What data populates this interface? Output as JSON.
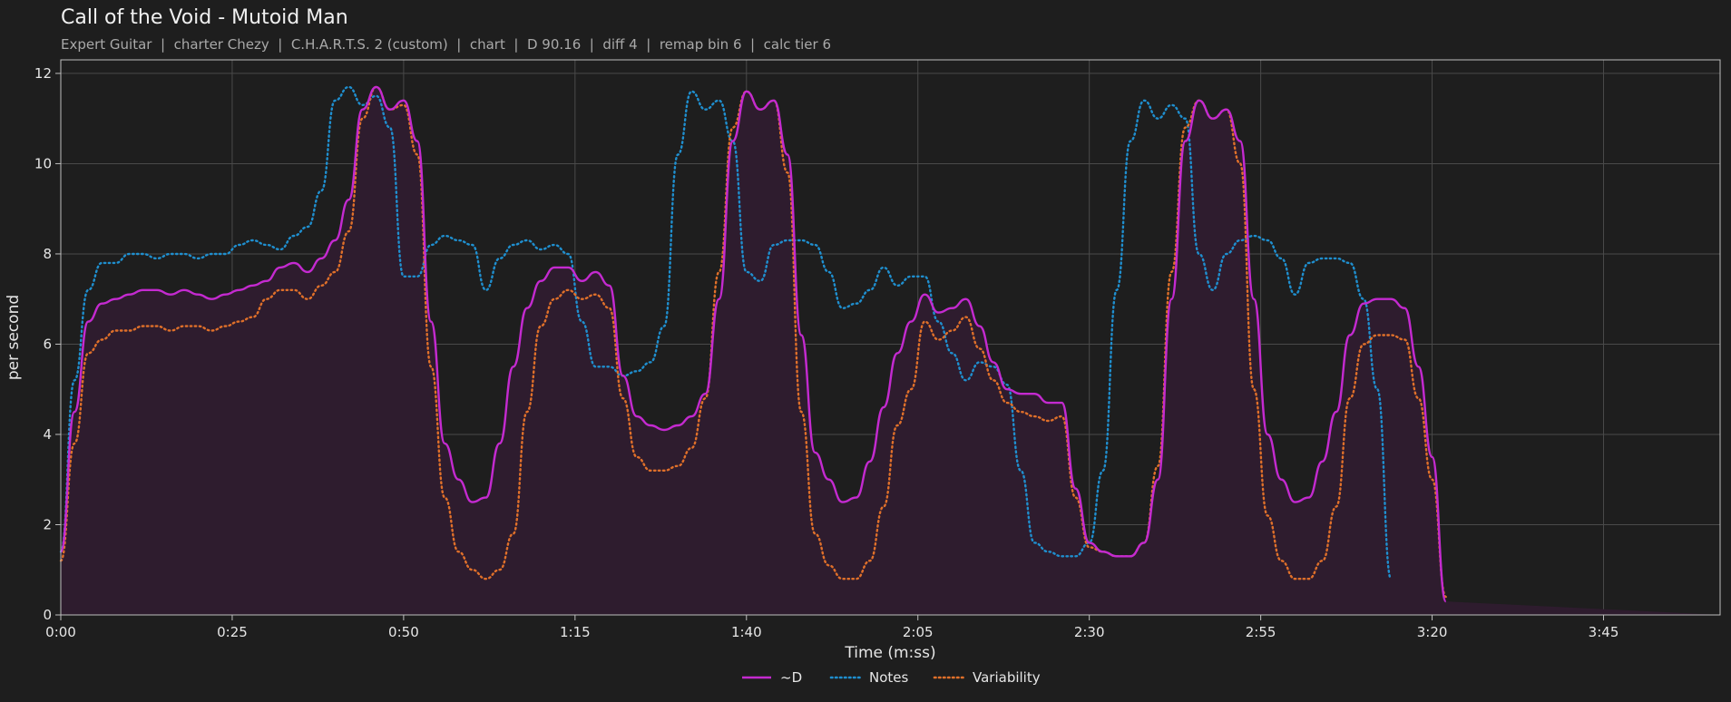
{
  "chart_data": {
    "type": "line",
    "title": "Call of the Void - Mutoid Man",
    "subtitle": "Expert Guitar  |  charter Chezy  |  C.H.A.R.T.S. 2 (custom)  |  chart  |  D 90.16  |  diff 4  |  remap bin 6  |  calc tier 6",
    "xlabel": "Time (m:ss)",
    "ylabel": "per second",
    "xlim": [
      0,
      242
    ],
    "ylim": [
      0,
      12.3
    ],
    "xticks": [
      {
        "value": 0,
        "label": "0:00"
      },
      {
        "value": 25,
        "label": "0:25"
      },
      {
        "value": 50,
        "label": "0:50"
      },
      {
        "value": 75,
        "label": "1:15"
      },
      {
        "value": 100,
        "label": "1:40"
      },
      {
        "value": 125,
        "label": "2:05"
      },
      {
        "value": 150,
        "label": "2:30"
      },
      {
        "value": 175,
        "label": "2:55"
      },
      {
        "value": 200,
        "label": "3:20"
      },
      {
        "value": 225,
        "label": "3:45"
      }
    ],
    "yticks": [
      {
        "value": 0,
        "label": "0"
      },
      {
        "value": 2,
        "label": "2"
      },
      {
        "value": 4,
        "label": "4"
      },
      {
        "value": 6,
        "label": "6"
      },
      {
        "value": 8,
        "label": "8"
      },
      {
        "value": 10,
        "label": "10"
      },
      {
        "value": 12,
        "label": "12"
      }
    ],
    "grid": true,
    "legend_position": "bottom-center",
    "x": [
      0,
      2,
      4,
      6,
      8,
      10,
      12,
      14,
      16,
      18,
      20,
      22,
      24,
      26,
      28,
      30,
      32,
      34,
      36,
      38,
      40,
      42,
      44,
      46,
      48,
      50,
      52,
      54,
      56,
      58,
      60,
      62,
      64,
      66,
      68,
      70,
      72,
      74,
      76,
      78,
      80,
      82,
      84,
      86,
      88,
      90,
      92,
      94,
      96,
      98,
      100,
      102,
      104,
      106,
      108,
      110,
      112,
      114,
      116,
      118,
      120,
      122,
      124,
      126,
      128,
      130,
      132,
      134,
      136,
      138,
      140,
      142,
      144,
      146,
      148,
      150,
      152,
      154,
      156,
      158,
      160,
      162,
      164,
      166,
      168,
      170,
      172,
      174,
      176,
      178,
      180,
      182,
      184,
      186,
      188,
      190,
      192,
      194,
      196,
      198,
      200,
      202,
      204,
      206,
      208,
      210,
      212,
      214,
      216,
      218,
      220,
      222,
      224,
      226,
      228,
      230,
      232,
      234,
      236,
      238,
      240,
      242
    ],
    "series": [
      {
        "name": "~D",
        "style": "solid",
        "color": "#c42ad0",
        "fill": "#2e1c2e",
        "values": [
          1.4,
          4.5,
          6.5,
          6.9,
          7.0,
          7.1,
          7.2,
          7.2,
          7.1,
          7.2,
          7.1,
          7.0,
          7.1,
          7.2,
          7.3,
          7.4,
          7.7,
          7.8,
          7.6,
          7.9,
          8.3,
          9.2,
          11.2,
          11.7,
          11.2,
          11.4,
          10.5,
          6.5,
          3.8,
          3.0,
          2.5,
          2.6,
          3.8,
          5.5,
          6.8,
          7.4,
          7.7,
          7.7,
          7.4,
          7.6,
          7.3,
          5.3,
          4.4,
          4.2,
          4.1,
          4.2,
          4.4,
          4.9,
          7.0,
          10.5,
          11.6,
          11.2,
          11.4,
          10.2,
          6.2,
          3.6,
          3.0,
          2.5,
          2.6,
          3.4,
          4.6,
          5.8,
          6.5,
          7.1,
          6.7,
          6.8,
          7.0,
          6.4,
          5.6,
          5.0,
          4.9,
          4.9,
          4.7,
          4.7,
          2.8,
          1.6,
          1.4,
          1.3,
          1.3,
          1.6,
          3.0,
          7.0,
          10.5,
          11.4,
          11.0,
          11.2,
          10.5,
          7.0,
          4.0,
          3.0,
          2.5,
          2.6,
          3.4,
          4.5,
          6.2,
          6.9,
          7.0,
          7.0,
          6.8,
          5.5,
          3.5,
          0.3
        ]
      },
      {
        "name": "Notes",
        "style": "dotted",
        "color": "#1f8fcf",
        "values": [
          1.4,
          5.2,
          7.2,
          7.8,
          7.8,
          8.0,
          8.0,
          7.9,
          8.0,
          8.0,
          7.9,
          8.0,
          8.0,
          8.2,
          8.3,
          8.2,
          8.1,
          8.4,
          8.6,
          9.4,
          11.4,
          11.7,
          11.3,
          11.5,
          10.8,
          7.5,
          7.5,
          8.2,
          8.4,
          8.3,
          8.2,
          7.2,
          7.9,
          8.2,
          8.3,
          8.1,
          8.2,
          8.0,
          6.5,
          5.5,
          5.5,
          5.3,
          5.4,
          5.6,
          6.4,
          10.2,
          11.6,
          11.2,
          11.4,
          10.5,
          7.6,
          7.4,
          8.2,
          8.3,
          8.3,
          8.2,
          7.6,
          6.8,
          6.9,
          7.2,
          7.7,
          7.3,
          7.5,
          7.5,
          6.5,
          5.8,
          5.2,
          5.6,
          5.5,
          5.1,
          3.2,
          1.6,
          1.4,
          1.3,
          1.3,
          1.6,
          3.2,
          7.2,
          10.5,
          11.4,
          11.0,
          11.3,
          11.0,
          8.0,
          7.2,
          8.0,
          8.3,
          8.4,
          8.3,
          7.9,
          7.1,
          7.8,
          7.9,
          7.9,
          7.8,
          7.0,
          5.0,
          0.8
        ]
      },
      {
        "name": "Variability",
        "style": "dotted",
        "color": "#e0702a",
        "values": [
          1.2,
          3.8,
          5.8,
          6.1,
          6.3,
          6.3,
          6.4,
          6.4,
          6.3,
          6.4,
          6.4,
          6.3,
          6.4,
          6.5,
          6.6,
          7.0,
          7.2,
          7.2,
          7.0,
          7.3,
          7.6,
          8.5,
          11.0,
          11.7,
          11.2,
          11.3,
          10.2,
          5.5,
          2.6,
          1.4,
          1.0,
          0.8,
          1.0,
          1.8,
          4.5,
          6.4,
          7.0,
          7.2,
          7.0,
          7.1,
          6.8,
          4.8,
          3.5,
          3.2,
          3.2,
          3.3,
          3.7,
          4.8,
          7.6,
          10.8,
          11.6,
          11.2,
          11.4,
          9.8,
          4.5,
          1.8,
          1.1,
          0.8,
          0.8,
          1.2,
          2.4,
          4.2,
          5.0,
          6.5,
          6.1,
          6.3,
          6.6,
          5.9,
          5.2,
          4.7,
          4.5,
          4.4,
          4.3,
          4.4,
          2.6,
          1.5,
          1.4,
          1.3,
          1.3,
          1.6,
          3.3,
          7.6,
          10.8,
          11.4,
          11.0,
          11.2,
          10.0,
          5.0,
          2.2,
          1.2,
          0.8,
          0.8,
          1.2,
          2.4,
          4.8,
          6.0,
          6.2,
          6.2,
          6.1,
          4.8,
          3.0,
          0.4
        ]
      }
    ]
  }
}
